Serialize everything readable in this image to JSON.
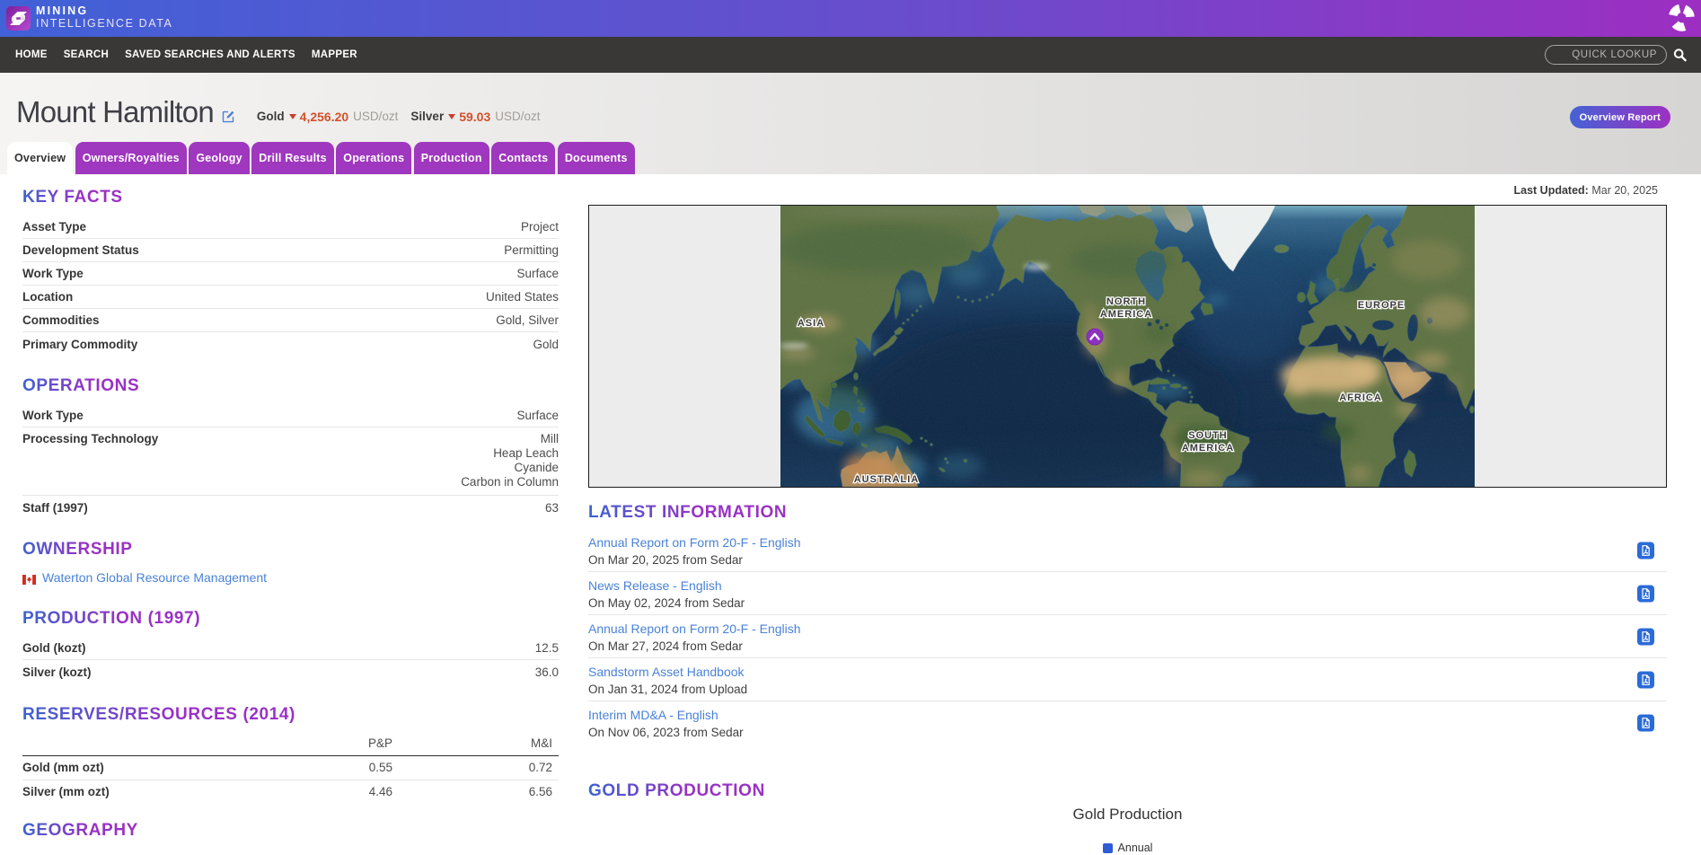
{
  "brand": {
    "line1": "MINING",
    "line2": "INTELLIGENCE DATA"
  },
  "nav": {
    "items": [
      "HOME",
      "SEARCH",
      "SAVED SEARCHES AND ALERTS",
      "MAPPER"
    ],
    "quick_lookup_placeholder": "QUICK LOOKUP"
  },
  "page": {
    "title": "Mount Hamilton",
    "prices": [
      {
        "label": "Gold",
        "value": "4,256.20",
        "unit": "USD/ozt"
      },
      {
        "label": "Silver",
        "value": "59.03",
        "unit": "USD/ozt"
      }
    ],
    "overview_report_label": "Overview Report",
    "tabs": [
      {
        "label": "Overview"
      },
      {
        "label": "Owners/Royalties"
      },
      {
        "label": "Geology"
      },
      {
        "label": "Drill Results"
      },
      {
        "label": "Operations"
      },
      {
        "label": "Production"
      },
      {
        "label": "Contacts"
      },
      {
        "label": "Documents"
      }
    ],
    "last_updated_label": "Last Updated:",
    "last_updated_value": "Mar 20, 2025"
  },
  "key_facts": {
    "heading": "KEY FACTS",
    "rows": [
      {
        "label": "Asset Type",
        "value": "Project"
      },
      {
        "label": "Development Status",
        "value": "Permitting"
      },
      {
        "label": "Work Type",
        "value": "Surface"
      },
      {
        "label": "Location",
        "value": "United States"
      },
      {
        "label": "Commodities",
        "value": "Gold, Silver"
      },
      {
        "label": "Primary Commodity",
        "value": "Gold"
      }
    ]
  },
  "operations": {
    "heading": "OPERATIONS",
    "work_type": {
      "label": "Work Type",
      "value": "Surface"
    },
    "processing": {
      "label": "Processing Technology",
      "values": [
        "Mill",
        "Heap Leach",
        "Cyanide",
        "Carbon in Column"
      ]
    },
    "staff": {
      "label": "Staff (1997)",
      "value": "63"
    }
  },
  "ownership": {
    "heading": "OWNERSHIP",
    "owner": "Waterton Global Resource Management"
  },
  "production": {
    "heading": "PRODUCTION (1997)",
    "rows": [
      {
        "label": "Gold (kozt)",
        "value": "12.5"
      },
      {
        "label": "Silver (kozt)",
        "value": "36.0"
      }
    ]
  },
  "reserves": {
    "heading": "RESERVES/RESOURCES (2014)",
    "columns": [
      "P&P",
      "M&I"
    ],
    "rows": [
      {
        "label": "Gold (mm ozt)",
        "v1": "0.55",
        "v2": "0.72"
      },
      {
        "label": "Silver (mm ozt)",
        "v1": "4.46",
        "v2": "6.56"
      }
    ]
  },
  "geography": {
    "heading": "GEOGRAPHY"
  },
  "map": {
    "labels": {
      "asia": "ASIA",
      "north_america_1": "NORTH",
      "north_america_2": "AMERICA",
      "europe": "EUROPE",
      "africa": "AFRICA",
      "south_america_1": "SOUTH",
      "south_america_2": "AMERICA",
      "australia": "AUSTRALIA"
    }
  },
  "latest_information": {
    "heading": "LATEST INFORMATION",
    "items": [
      {
        "title": "Annual Report on Form 20-F - English",
        "meta": "On Mar 20, 2025 from Sedar"
      },
      {
        "title": "News Release - English",
        "meta": "On May 02, 2024 from Sedar"
      },
      {
        "title": "Annual Report on Form 20-F - English",
        "meta": "On Mar 27, 2024 from Sedar"
      },
      {
        "title": "Sandstorm Asset Handbook",
        "meta": "On Jan 31, 2024 from Upload"
      },
      {
        "title": "Interim MD&A - English",
        "meta": "On Nov 06, 2023 from Sedar"
      }
    ]
  },
  "gold_production": {
    "heading": "GOLD PRODUCTION"
  },
  "chart_data": {
    "type": "bar",
    "title": "Gold Production",
    "legend": [
      "Annual"
    ],
    "series_color": "#2f5bd7",
    "note": "chart body cut off at bottom of viewport"
  }
}
